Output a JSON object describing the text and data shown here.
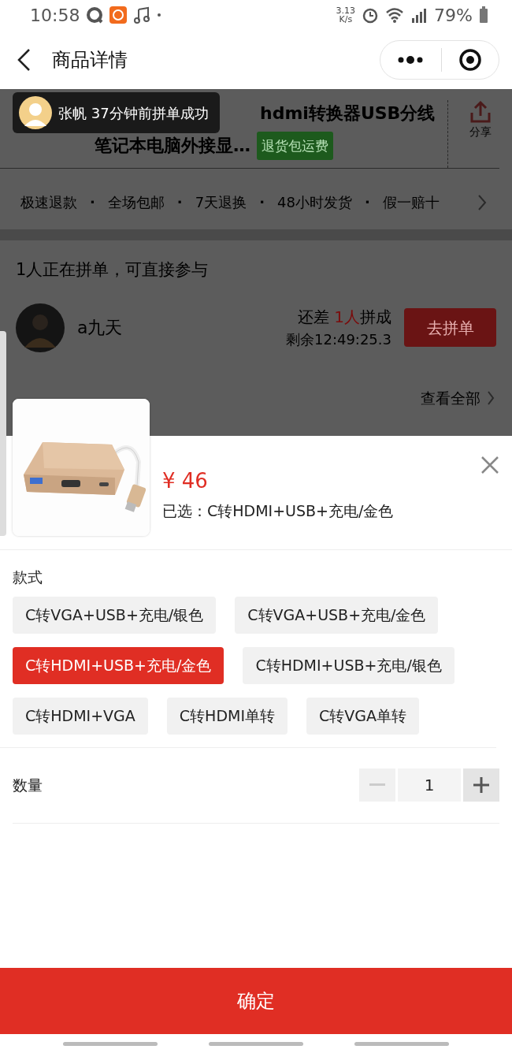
{
  "status_bar": {
    "time": "10:58",
    "speed_value": "3.13",
    "speed_unit": "K/s",
    "battery": "79%"
  },
  "nav": {
    "title": "商品详情"
  },
  "product": {
    "title_line_1": "hdmi转换器USB分线",
    "title_line_2": "笔记本电脑外接显…",
    "badge": "退货包运费",
    "share": "分享"
  },
  "toast": {
    "text": "张帆 37分钟前拼单成功"
  },
  "services": {
    "separator": "·",
    "items": [
      "极速退款",
      "全场包邮",
      "7天退换",
      "48小时发货",
      "假一赔十"
    ]
  },
  "group_buy": {
    "heading": "1人正在拼单，可直接参与",
    "member": {
      "name": "a九天",
      "need_prefix": "还差 ",
      "need_count": "1人",
      "need_suffix": "拼成",
      "remaining": "剩余12:49:25.3",
      "button": "去拼单"
    },
    "view_all": "查看全部"
  },
  "sheet": {
    "price": "¥ 46",
    "selected_text": "已选：C转HDMI+USB+充电/金色",
    "section": "款式",
    "options": [
      {
        "label": "C转VGA+USB+充电/银色",
        "selected": false
      },
      {
        "label": "C转VGA+USB+充电/金色",
        "selected": false
      },
      {
        "label": "C转HDMI+USB+充电/金色",
        "selected": true
      },
      {
        "label": "C转HDMI+USB+充电/银色",
        "selected": false
      },
      {
        "label": "C转HDMI+VGA",
        "selected": false
      },
      {
        "label": "C转HDMI单转",
        "selected": false
      },
      {
        "label": "C转VGA单转",
        "selected": false
      }
    ],
    "quantity": {
      "label": "数量",
      "value": "1",
      "minus_disabled": true
    },
    "confirm": "确定"
  }
}
